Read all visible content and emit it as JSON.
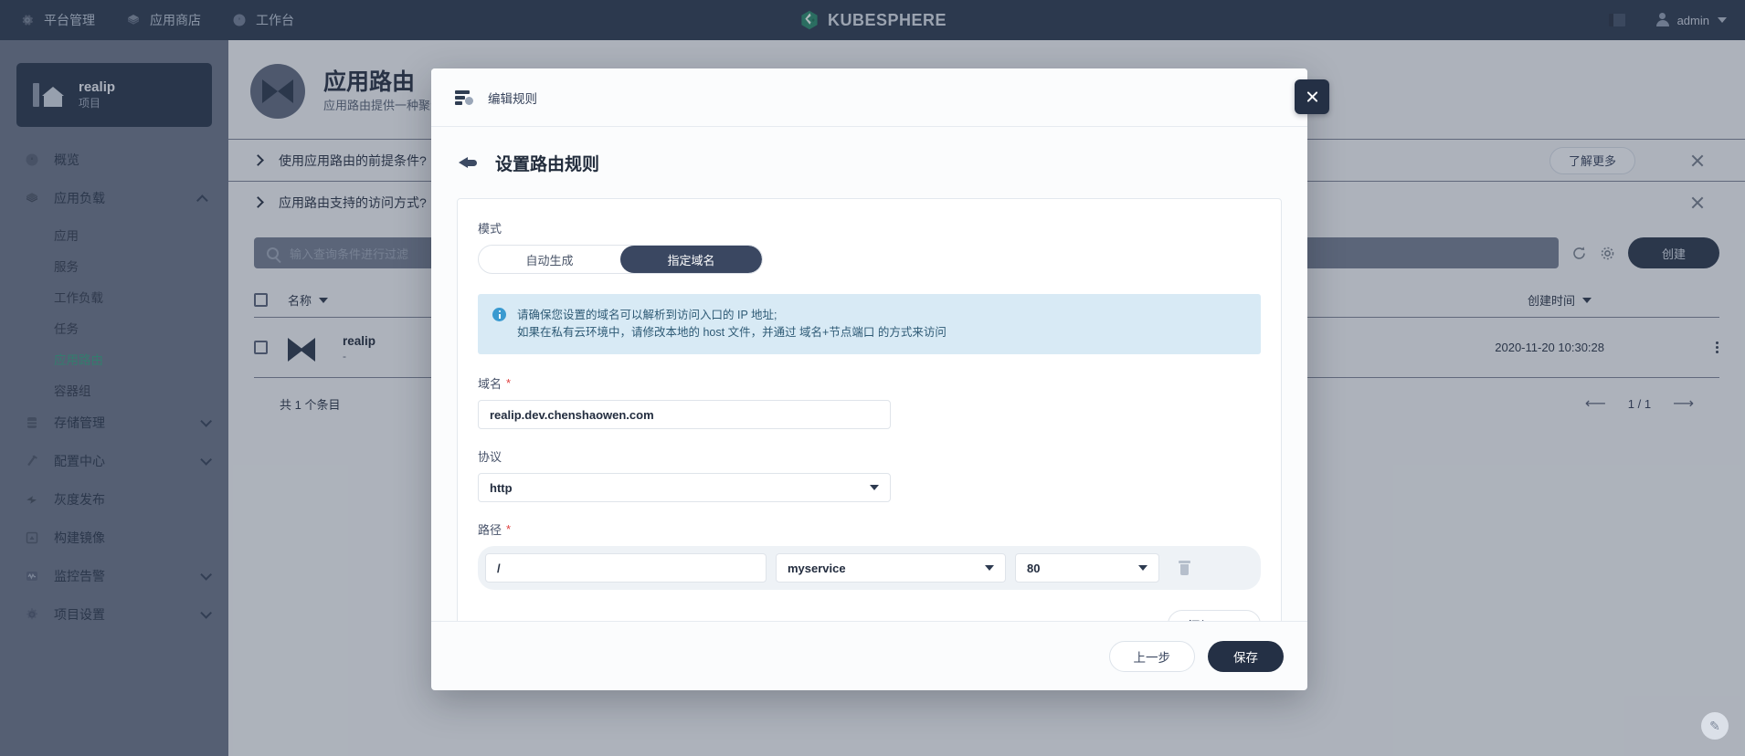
{
  "topnav": {
    "items": [
      {
        "label": "平台管理",
        "icon": "gear-icon"
      },
      {
        "label": "应用商店",
        "icon": "store-icon"
      },
      {
        "label": "工作台",
        "icon": "dashboard-icon"
      }
    ],
    "brand": "KUBESPHERE",
    "doc_icon": "docs-icon",
    "user": "admin"
  },
  "sidebar": {
    "project": {
      "name": "realip",
      "type": "项目"
    },
    "items": [
      {
        "label": "概览",
        "icon": "overview-icon",
        "chevron": "",
        "active": false
      },
      {
        "label": "应用负载",
        "icon": "workload-icon",
        "chevron": "up",
        "active": false
      },
      {
        "label": "存储管理",
        "icon": "storage-icon",
        "chevron": "down",
        "active": false
      },
      {
        "label": "配置中心",
        "icon": "config-icon",
        "chevron": "down",
        "active": false
      },
      {
        "label": "灰度发布",
        "icon": "grayscale-icon",
        "chevron": "",
        "active": false
      },
      {
        "label": "构建镜像",
        "icon": "image-build-icon",
        "chevron": "",
        "active": false
      },
      {
        "label": "监控告警",
        "icon": "monitor-icon",
        "chevron": "down",
        "active": false
      },
      {
        "label": "项目设置",
        "icon": "settings-icon",
        "chevron": "down",
        "active": false
      }
    ],
    "sub_items": [
      {
        "label": "应用",
        "active": false
      },
      {
        "label": "服务",
        "active": false
      },
      {
        "label": "工作负载",
        "active": false
      },
      {
        "label": "任务",
        "active": false
      },
      {
        "label": "应用路由",
        "active": true
      },
      {
        "label": "容器组",
        "active": false
      }
    ]
  },
  "page": {
    "title": "应用路由",
    "desc": "应用路由提供一种聚合服...",
    "tips": [
      {
        "label": "使用应用路由的前提条件?"
      },
      {
        "label": "应用路由支持的访问方式?"
      }
    ],
    "learn_more": "了解更多",
    "search_placeholder": "输入查询条件进行过滤",
    "create_label": "创建",
    "refresh_icon": "refresh-icon",
    "gear_icon": "gear-icon",
    "table": {
      "columns": [
        "名称",
        "创建时间"
      ],
      "rows": [
        {
          "name": "realip",
          "sub": "-",
          "created": "2020-11-20 10:30:28"
        }
      ],
      "total_text": "共 1 个条目",
      "page_text": "1 / 1"
    }
  },
  "modal": {
    "header_title": "编辑规则",
    "header_icon": "rule-icon",
    "close_icon": "close-icon",
    "back_icon": "back-arrow-icon",
    "step_title": "设置路由规则",
    "mode": {
      "label": "模式",
      "options": [
        "自动生成",
        "指定域名"
      ],
      "selected": "指定域名"
    },
    "alert": {
      "icon": "info-icon",
      "line1": "请确保您设置的域名可以解析到访问入口的 IP 地址;",
      "line2": "如果在私有云环境中，请修改本地的 host 文件，并通过 域名+节点端口 的方式来访问"
    },
    "domain": {
      "label": "域名",
      "required": "*",
      "value": "realip.dev.chenshaowen.com"
    },
    "protocol": {
      "label": "协议",
      "value": "http"
    },
    "path": {
      "label": "路径",
      "required": "*",
      "rows": [
        {
          "path": "/",
          "service": "myservice",
          "port": "80",
          "delete_icon": "trash-icon"
        }
      ],
      "add_label": "添加 Path"
    },
    "footer": {
      "prev_label": "上一步",
      "save_label": "保存"
    }
  },
  "fab": {
    "icon": "pencil-icon",
    "glyph": "✎"
  },
  "colors": {
    "brand_green": "#2f8a6f",
    "dark_navy": "#243045",
    "topnav_bg": "#303e53",
    "alert_bg": "#d8eaf5",
    "required_red": "#e0403f",
    "active_green": "#3b9e82"
  }
}
